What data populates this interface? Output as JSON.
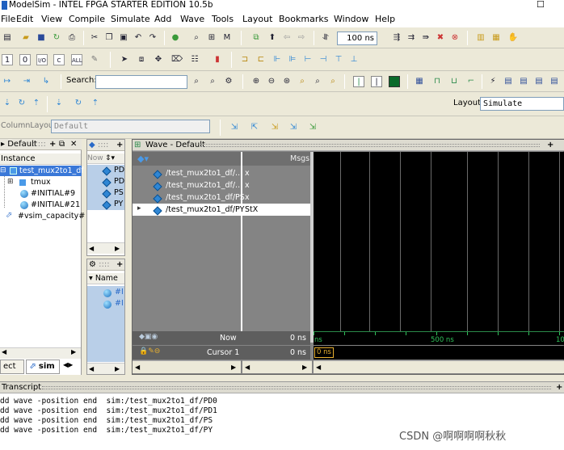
{
  "window": {
    "title": "ModelSim - INTEL FPGA STARTER EDITION 10.5b",
    "close_glyph": "☐"
  },
  "menu": [
    "File",
    "Edit",
    "View",
    "Compile",
    "Simulate",
    "Add",
    "Wave",
    "Tools",
    "Layout",
    "Bookmarks",
    "Window",
    "Help"
  ],
  "toolbar": {
    "run_length": "100 ns",
    "search_label": "Search:",
    "search_value": "",
    "layout_label": "Layout",
    "layout_value": "Simulate",
    "column_layout_label": "ColumnLayout",
    "column_layout_value": "Default"
  },
  "instance_panel": {
    "title": "Default",
    "header": "Instance",
    "items": [
      "test_mux2to1_df",
      "tmux",
      "#INITIAL#9",
      "#INITIAL#21",
      "#vsim_capacity#"
    ],
    "tabs": [
      "ect",
      "sim"
    ]
  },
  "objects_panel": {
    "header": "Now",
    "items": [
      "PD",
      "PD",
      "PS",
      "PY"
    ]
  },
  "processes_panel": {
    "header": "Name",
    "items": [
      "#I",
      "#I"
    ]
  },
  "wave": {
    "title": "Wave - Default",
    "msgs_header": "Msgs",
    "signals": [
      {
        "name": "/test_mux2to1_df/...",
        "value": "x"
      },
      {
        "name": "/test_mux2to1_df/...",
        "value": "x"
      },
      {
        "name": "/test_mux2to1_df/PS",
        "value": "x"
      },
      {
        "name": "/test_mux2to1_df/PY",
        "value": "StX"
      }
    ],
    "now_label": "Now",
    "now_value": "0 ns",
    "cursor_label": "Cursor 1",
    "cursor_value": "0 ns",
    "cursor_tag": "0 ns",
    "time_ticks": [
      "ns",
      "500 ns",
      "10"
    ]
  },
  "transcript": {
    "title": "Transcript",
    "lines": [
      "dd wave -position end  sim:/test_mux2to1_df/PD0",
      "dd wave -position end  sim:/test_mux2to1_df/PD1",
      "dd wave -position end  sim:/test_mux2to1_df/PS",
      "dd wave -position end  sim:/test_mux2to1_df/PY"
    ]
  },
  "watermark": "CSDN @啊啊啊啊秋秋",
  "colors": {
    "wave_bg": "#000000",
    "signal_bg": "#848484",
    "selected": "#ffffff",
    "accent": "#2f86d4"
  }
}
